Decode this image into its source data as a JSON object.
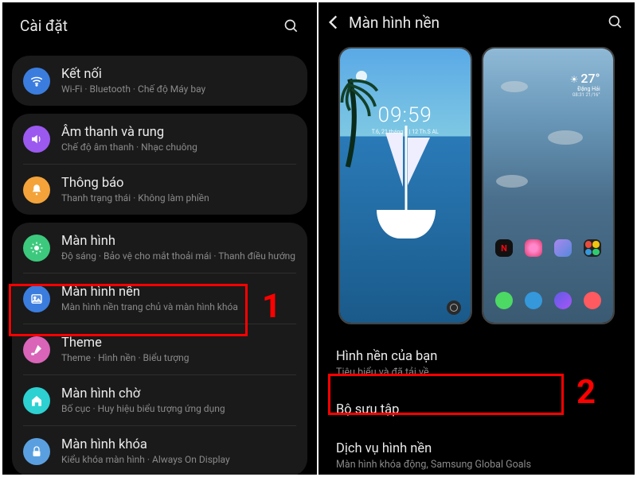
{
  "left": {
    "title": "Cài đặt",
    "groups": [
      {
        "items": [
          {
            "id": "connections",
            "icon": "wifi",
            "iconColor": "ic-blue",
            "title": "Kết nối",
            "sub": "Wi-Fi · Bluetooth · Chế độ Máy bay"
          }
        ]
      },
      {
        "items": [
          {
            "id": "sound",
            "icon": "sound",
            "iconColor": "ic-purple",
            "title": "Âm thanh và rung",
            "sub": "Chế độ âm thanh · Nhạc chuông"
          },
          {
            "id": "notifications",
            "icon": "bell",
            "iconColor": "ic-orange",
            "title": "Thông báo",
            "sub": "Thanh trạng thái · Không làm phiền"
          }
        ]
      },
      {
        "items": [
          {
            "id": "display",
            "icon": "sun",
            "iconColor": "ic-green",
            "title": "Màn hình",
            "sub": "Độ sáng · Bảo vệ cho mắt thoải mái · Thanh điều hướng"
          },
          {
            "id": "wallpaper",
            "icon": "image",
            "iconColor": "ic-blue",
            "title": "Màn hình nền",
            "sub": "Màn hình nền trang chủ và màn hình khóa"
          },
          {
            "id": "theme",
            "icon": "brush",
            "iconColor": "ic-pink",
            "title": "Theme",
            "sub": "Theme · Hình nền · Biểu tượng"
          },
          {
            "id": "homescreen",
            "icon": "home",
            "iconColor": "ic-cyan",
            "title": "Màn hình chờ",
            "sub": "Bố cục · Huy hiệu biểu tượng ứng dụng"
          },
          {
            "id": "lockscreen",
            "icon": "lock",
            "iconColor": "ic-lock",
            "title": "Màn hình khóa",
            "sub": "Kiểu khóa màn hình · Always On Display"
          }
        ]
      }
    ],
    "highlightNumber": "1"
  },
  "right": {
    "title": "Màn hình nền",
    "lockPreview": {
      "time": "09:59",
      "date": "T.6, 21 tháng 7 | 12 Th.S AL"
    },
    "homePreview": {
      "temp": "27°",
      "loc": "Đặng Hải",
      "range": "08:31  21/16°"
    },
    "list": [
      {
        "id": "your-wallpapers",
        "title": "Hình nền của bạn",
        "sub": "Tiêu biểu và đã tải về"
      },
      {
        "id": "gallery",
        "title": "Bộ sưu tập",
        "sub": ""
      },
      {
        "id": "wallpaper-services",
        "title": "Dịch vụ hình nền",
        "sub": "Màn hình khóa động, Samsung Global Goals"
      }
    ],
    "highlightNumber": "2"
  }
}
